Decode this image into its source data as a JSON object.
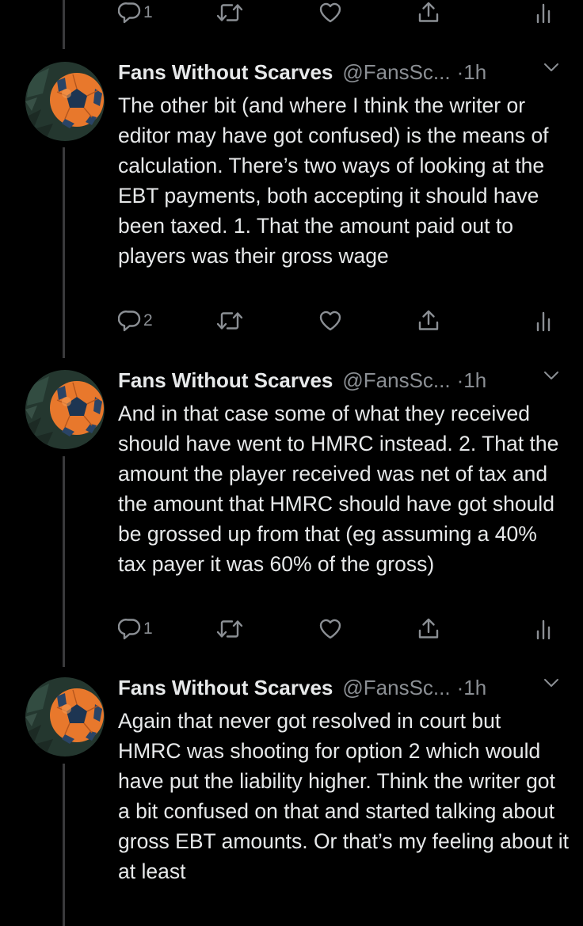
{
  "colors": {
    "background": "#000000",
    "text": "#e7e9ea",
    "muted": "#8b8f94",
    "thread_line": "#3a3a3c"
  },
  "top_actions": {
    "reply_count": "1"
  },
  "tweets": [
    {
      "name": "Fans Without Scarves",
      "handle": "@FansSc...",
      "separator": "·",
      "time": "1h",
      "text": "The other bit (and where I think the writer or editor may have got confused) is the means of calculation. There’s two ways of looking at the EBT payments, both accepting it should have been taxed. 1. That the amount paid out to players was their gross wage",
      "reply_count": "2"
    },
    {
      "name": "Fans Without Scarves",
      "handle": "@FansSc...",
      "separator": "·",
      "time": "1h",
      "text": "And in that case some of what they received should have went to HMRC instead. 2. That the amount the player received was net of tax and the amount that HMRC should have got should be grossed up from that (eg assuming a 40% tax payer it was 60% of the gross)",
      "reply_count": "1"
    },
    {
      "name": "Fans Without Scarves",
      "handle": "@FansSc...",
      "separator": "·",
      "time": "1h",
      "text": "Again that never got resolved in court but HMRC was shooting for option 2 which would have put the liability higher. Think the writer got a bit confused on that and started talking about gross EBT amounts. Or that’s my feeling about it at least"
    }
  ],
  "icons": {
    "reply": "reply-icon",
    "retweet": "retweet-icon",
    "like": "heart-icon",
    "share": "share-icon",
    "analytics": "analytics-icon",
    "more": "chevron-down-icon"
  }
}
